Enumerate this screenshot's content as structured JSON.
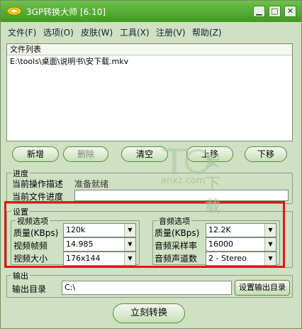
{
  "window": {
    "title": "3GP转换大师 [6.10]",
    "controls": {
      "minimize": "▁",
      "maximize": "□",
      "close": "✕"
    }
  },
  "menu": [
    {
      "label": "文件(F)"
    },
    {
      "label": "选项(O)"
    },
    {
      "label": "皮肤(W)"
    },
    {
      "label": "工具(X)"
    },
    {
      "label": "注册(V)"
    },
    {
      "label": "帮助(Z)"
    }
  ],
  "file_list": {
    "header": "文件列表",
    "items": [
      "E:\\tools\\桌面\\说明书\\安下载.mkv"
    ]
  },
  "list_buttons": {
    "add": "新增",
    "delete": "删除",
    "clear": "清空",
    "move_up": "上移",
    "move_down": "下移"
  },
  "progress": {
    "title": "进度",
    "operation_label": "当前操作描述",
    "operation_value": "准备就绪",
    "file_label": "当前文件进度"
  },
  "settings": {
    "title": "设置",
    "video": {
      "title": "视频选项",
      "quality_label": "质量(KBps)",
      "quality_value": "120k",
      "fps_label": "视频帧频",
      "fps_value": "14.985",
      "size_label": "视频大小",
      "size_value": "176x144"
    },
    "audio": {
      "title": "音频选项",
      "quality_label": "质量(KBps)",
      "quality_value": "12.2K",
      "rate_label": "音频采样率",
      "rate_value": "16000",
      "channels_label": "音频声道数",
      "channels_value": "2 - Stereo"
    }
  },
  "output": {
    "title": "输出",
    "dir_label": "输出目录",
    "dir_value": "C:\\",
    "set_button": "设置输出目录"
  },
  "convert_button": "立刻转换",
  "watermark": {
    "brand": "安下载",
    "domain": "anxz.com"
  },
  "colors": {
    "window_bg": "#cfe0c3",
    "titlebar": "#4faa2e",
    "highlight": "#e01818"
  }
}
